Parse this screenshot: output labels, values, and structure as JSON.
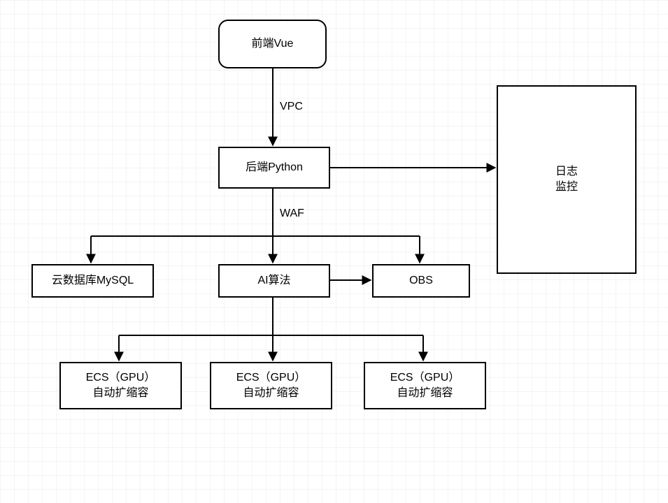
{
  "diagram": {
    "nodes": {
      "frontend": {
        "label": "前端Vue"
      },
      "backend": {
        "label": "后端Python"
      },
      "log_monitor": {
        "line1": "日志",
        "line2": "监控"
      },
      "db": {
        "label": "云数据库MySQL"
      },
      "ai": {
        "label": "AI算法"
      },
      "obs": {
        "label": "OBS"
      },
      "ecs1": {
        "line1": "ECS（GPU）",
        "line2": "自动扩缩容"
      },
      "ecs2": {
        "line1": "ECS（GPU）",
        "line2": "自动扩缩容"
      },
      "ecs3": {
        "line1": "ECS（GPU）",
        "line2": "自动扩缩容"
      }
    },
    "edges": {
      "vpc": {
        "label": "VPC"
      },
      "waf": {
        "label": "WAF"
      }
    }
  }
}
